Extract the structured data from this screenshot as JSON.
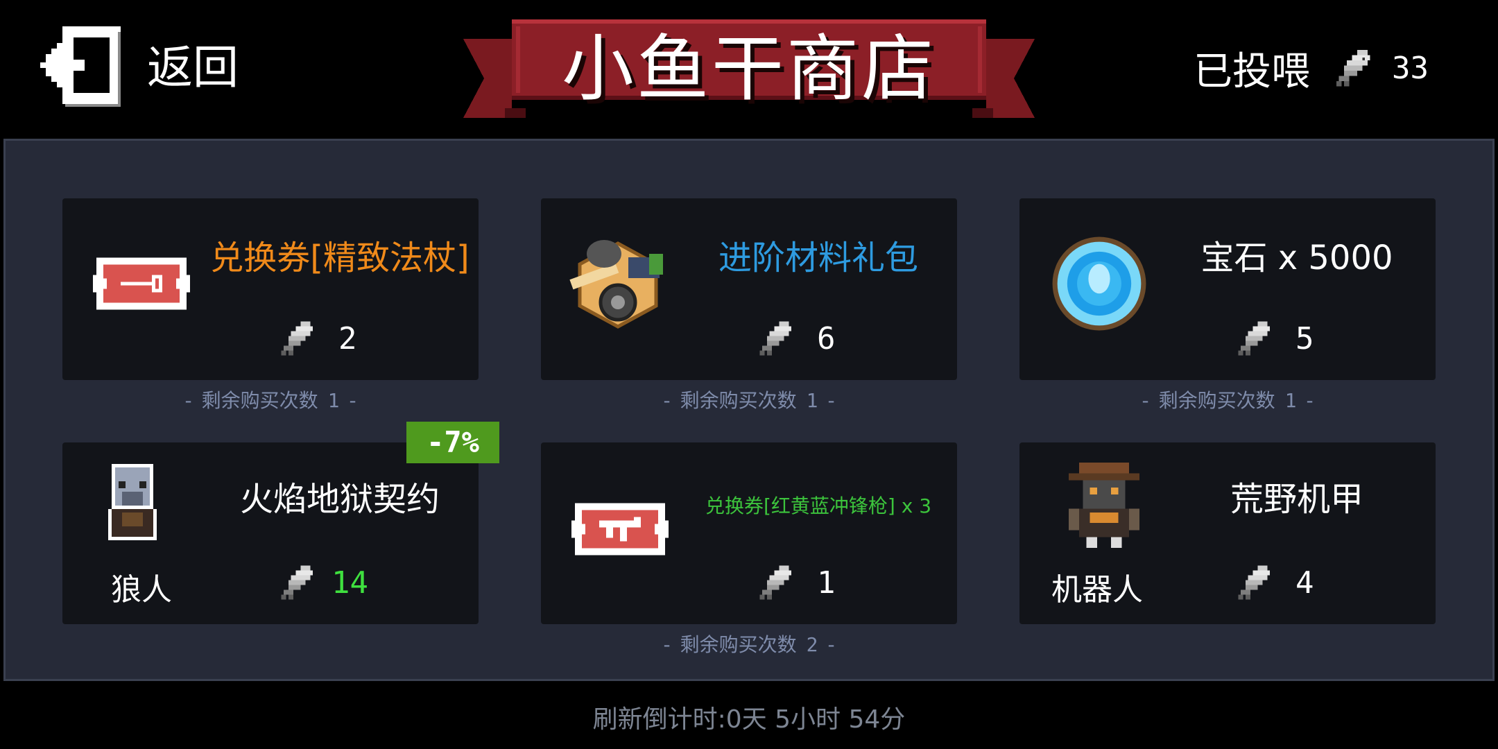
{
  "header": {
    "back_label": "返回",
    "shop_title": "小鱼干商店",
    "fed_label": "已投喂",
    "fed_count": "33",
    "fed_icon": "fish-icon"
  },
  "colors": {
    "panel_bg": "#262a38",
    "card_bg": "#121419",
    "banner_red": "#8c1f27",
    "title_orange": "#f08a1a",
    "title_blue": "#2e9be0",
    "title_green": "#3cc43c",
    "discount_green": "#4f9a1e",
    "muted_text": "#7f8cab"
  },
  "items": [
    {
      "title": "兑换券[精致法杖]",
      "price": "2",
      "icon": "staff-voucher-icon",
      "remaining_label": "剩余购买次数",
      "remaining": "1"
    },
    {
      "title": "进阶材料礼包",
      "price": "6",
      "icon": "materials-pack-icon",
      "remaining_label": "剩余购买次数",
      "remaining": "1"
    },
    {
      "title": "宝石 x 5000",
      "price": "5",
      "icon": "gem-icon",
      "remaining_label": "剩余购买次数",
      "remaining": "1"
    },
    {
      "title": "火焰地狱契约",
      "subname": "狼人",
      "price": "14",
      "icon": "werewolf-icon",
      "discount": "-7%"
    },
    {
      "title": "兑换券[红黄蓝冲锋枪] x 3",
      "price": "1",
      "icon": "smg-voucher-icon",
      "remaining_label": "剩余购买次数",
      "remaining": "2"
    },
    {
      "title": "荒野机甲",
      "subname": "机器人",
      "price": "4",
      "icon": "robot-icon"
    }
  ],
  "footer": {
    "refresh_text": "刷新倒计时:0天 5小时 54分"
  }
}
